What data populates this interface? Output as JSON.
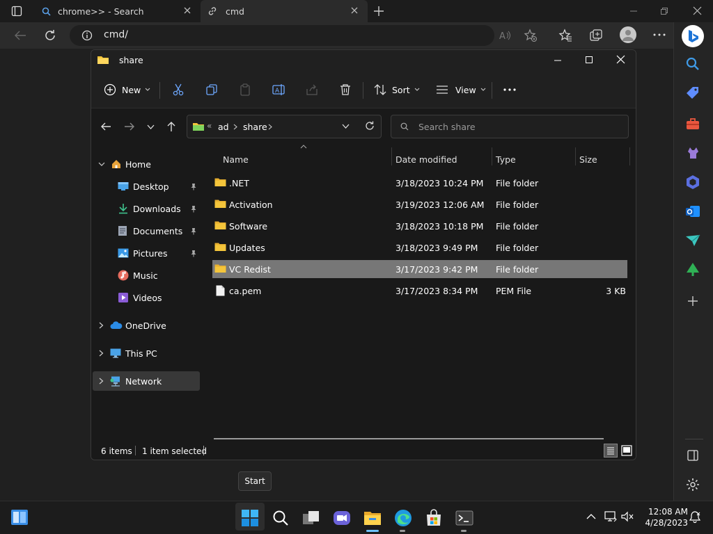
{
  "browser": {
    "tabs": [
      {
        "label": "chrome>> - Search",
        "icon": "search-icon"
      },
      {
        "label": "cmd",
        "icon": "tab-page-icon"
      }
    ],
    "address": "cmd/"
  },
  "explorer": {
    "title": "share",
    "toolbar": {
      "new_label": "New",
      "sort_label": "Sort",
      "view_label": "View"
    },
    "breadcrumb": {
      "overflow": "«",
      "parts": [
        "ad",
        "share"
      ]
    },
    "search_placeholder": "Search share",
    "nav": {
      "home": "Home",
      "quick": [
        {
          "label": "Desktop",
          "pinned": true
        },
        {
          "label": "Downloads",
          "pinned": true
        },
        {
          "label": "Documents",
          "pinned": true
        },
        {
          "label": "Pictures",
          "pinned": true
        },
        {
          "label": "Music",
          "pinned": false
        },
        {
          "label": "Videos",
          "pinned": false
        }
      ],
      "onedrive": "OneDrive",
      "thispc": "This PC",
      "network": "Network"
    },
    "columns": {
      "name": "Name",
      "date": "Date modified",
      "type": "Type",
      "size": "Size"
    },
    "files": [
      {
        "name": ".NET",
        "date": "3/18/2023 10:24 PM",
        "type": "File folder",
        "size": "",
        "kind": "folder"
      },
      {
        "name": "Activation",
        "date": "3/19/2023 12:06 AM",
        "type": "File folder",
        "size": "",
        "kind": "folder"
      },
      {
        "name": "Software",
        "date": "3/18/2023 10:18 PM",
        "type": "File folder",
        "size": "",
        "kind": "folder"
      },
      {
        "name": "Updates",
        "date": "3/18/2023 9:49 PM",
        "type": "File folder",
        "size": "",
        "kind": "folder"
      },
      {
        "name": "VC Redist",
        "date": "3/17/2023 9:42 PM",
        "type": "File folder",
        "size": "",
        "kind": "folder",
        "selected": true
      },
      {
        "name": "ca.pem",
        "date": "3/17/2023 8:34 PM",
        "type": "PEM File",
        "size": "3 KB",
        "kind": "file"
      }
    ],
    "status": {
      "count": "6 items",
      "selected": "1 item selected"
    }
  },
  "tooltip": "Start",
  "clock": {
    "time": "12:08 AM",
    "date": "4/28/2023"
  },
  "colors": {
    "folder": "#f4c53b",
    "accent": "#0078d4",
    "selection": "#777777"
  }
}
